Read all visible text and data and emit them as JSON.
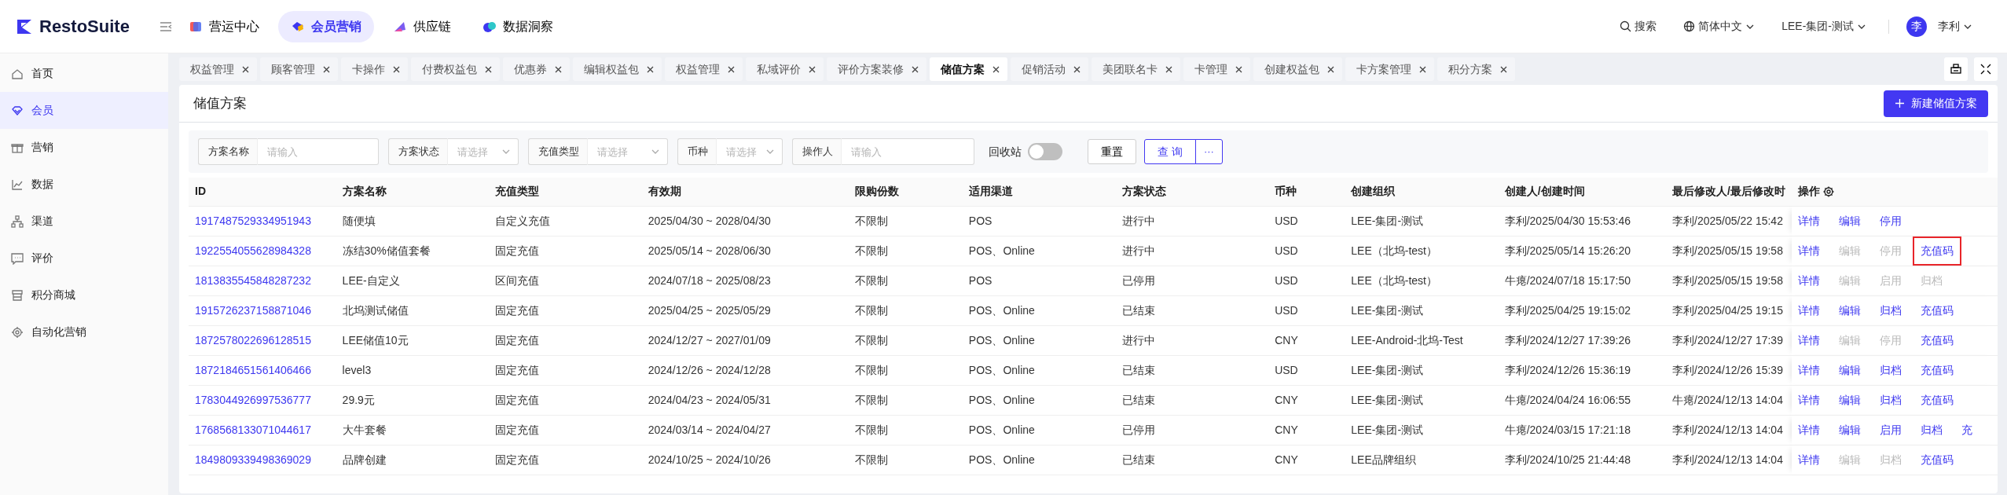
{
  "app": {
    "logo": "RestoSuite"
  },
  "top_nav": [
    {
      "label": "营运中心",
      "selected": false
    },
    {
      "label": "会员营销",
      "selected": true
    },
    {
      "label": "供应链",
      "selected": false
    },
    {
      "label": "数据洞察",
      "selected": false
    }
  ],
  "header_right": {
    "search": "搜索",
    "language": "简体中文",
    "org": "LEE-集团-测试",
    "user": {
      "avatar": "李",
      "name": "李利"
    }
  },
  "sidebar": {
    "items": [
      {
        "label": "首页",
        "selected": false
      },
      {
        "label": "会员",
        "selected": true
      },
      {
        "label": "营销",
        "selected": false
      },
      {
        "label": "数据",
        "selected": false
      },
      {
        "label": "渠道",
        "selected": false
      },
      {
        "label": "评价",
        "selected": false
      },
      {
        "label": "积分商城",
        "selected": false
      },
      {
        "label": "自动化营销",
        "selected": false
      }
    ]
  },
  "tabs": [
    {
      "label": "权益管理",
      "selected": false
    },
    {
      "label": "顾客管理",
      "selected": false
    },
    {
      "label": "卡操作",
      "selected": false
    },
    {
      "label": "付费权益包",
      "selected": false
    },
    {
      "label": "优惠券",
      "selected": false
    },
    {
      "label": "编辑权益包",
      "selected": false
    },
    {
      "label": "权益管理",
      "selected": false
    },
    {
      "label": "私域评价",
      "selected": false
    },
    {
      "label": "评价方案装修",
      "selected": false
    },
    {
      "label": "储值方案",
      "selected": true
    },
    {
      "label": "促销活动",
      "selected": false
    },
    {
      "label": "美团联名卡",
      "selected": false
    },
    {
      "label": "卡管理",
      "selected": false
    },
    {
      "label": "创建权益包",
      "selected": false
    },
    {
      "label": "卡方案管理",
      "selected": false
    },
    {
      "label": "积分方案",
      "selected": false
    }
  ],
  "page": {
    "title": "储值方案",
    "new_button": "新建储值方案"
  },
  "filters": [
    {
      "kind": "input",
      "label": "方案名称",
      "placeholder": "请输入"
    },
    {
      "kind": "select",
      "label": "方案状态",
      "placeholder": "请选择"
    },
    {
      "kind": "select",
      "label": "充值类型",
      "placeholder": "请选择"
    },
    {
      "kind": "select",
      "label": "币种",
      "placeholder": "请选择"
    },
    {
      "kind": "input",
      "label": "操作人",
      "placeholder": "请输入"
    }
  ],
  "recycle_bin": {
    "label": "回收站",
    "on": false
  },
  "buttons": {
    "reset": "重置",
    "query": "查 询",
    "more": "···"
  },
  "table": {
    "columns": [
      "ID",
      "方案名称",
      "充值类型",
      "有效期",
      "限购份数",
      "适用渠道",
      "方案状态",
      "币种",
      "创建组织",
      "创建人/创建时间",
      "最后修改人/最后修改时",
      "操作"
    ],
    "rows": [
      {
        "cells": [
          "1917487529334951943",
          "随便填",
          "自定义充值",
          "2025/04/30 ~ 2028/04/30",
          "不限制",
          "POS",
          "进行中",
          "USD",
          "LEE-集团-测试",
          "李利/2025/04/30 15:53:46",
          "李利/2025/05/22 15:42"
        ],
        "actions": [
          {
            "label": "详情",
            "disabled": false,
            "highlighted": false
          },
          {
            "label": "编辑",
            "disabled": false,
            "highlighted": false
          },
          {
            "label": "停用",
            "disabled": false,
            "highlighted": false
          }
        ]
      },
      {
        "cells": [
          "1922554055628984328",
          "冻结30%储值套餐",
          "固定充值",
          "2025/05/14 ~ 2028/06/30",
          "不限制",
          "POS、Online",
          "进行中",
          "USD",
          "LEE（北坞-test）",
          "李利/2025/05/14 15:26:20",
          "李利/2025/05/15 19:58"
        ],
        "actions": [
          {
            "label": "详情",
            "disabled": false,
            "highlighted": false
          },
          {
            "label": "编辑",
            "disabled": true,
            "highlighted": false
          },
          {
            "label": "停用",
            "disabled": true,
            "highlighted": false
          },
          {
            "label": "充值码",
            "disabled": false,
            "highlighted": true
          }
        ]
      },
      {
        "cells": [
          "1813835545848287232",
          "LEE-自定义",
          "区间充值",
          "2024/07/18 ~ 2025/08/23",
          "不限制",
          "POS",
          "已停用",
          "USD",
          "LEE（北坞-test）",
          "牛瘪/2024/07/18 15:17:50",
          "李利/2025/05/15 19:58"
        ],
        "actions": [
          {
            "label": "详情",
            "disabled": false,
            "highlighted": false
          },
          {
            "label": "编辑",
            "disabled": true,
            "highlighted": false
          },
          {
            "label": "启用",
            "disabled": true,
            "highlighted": false
          },
          {
            "label": "归档",
            "disabled": true,
            "highlighted": false
          }
        ]
      },
      {
        "cells": [
          "1915726237158871046",
          "北坞测试储值",
          "固定充值",
          "2025/04/25 ~ 2025/05/29",
          "不限制",
          "POS、Online",
          "已结束",
          "USD",
          "LEE-集团-测试",
          "李利/2025/04/25 19:15:02",
          "李利/2025/04/25 19:15"
        ],
        "actions": [
          {
            "label": "详情",
            "disabled": false,
            "highlighted": false
          },
          {
            "label": "编辑",
            "disabled": false,
            "highlighted": false
          },
          {
            "label": "归档",
            "disabled": false,
            "highlighted": false
          },
          {
            "label": "充值码",
            "disabled": false,
            "highlighted": false
          }
        ]
      },
      {
        "cells": [
          "1872578022696128515",
          "LEE储值10元",
          "固定充值",
          "2024/12/27 ~ 2027/01/09",
          "不限制",
          "POS、Online",
          "进行中",
          "CNY",
          "LEE-Android-北坞-Test",
          "李利/2024/12/27 17:39:26",
          "李利/2024/12/27 17:39"
        ],
        "actions": [
          {
            "label": "详情",
            "disabled": false,
            "highlighted": false
          },
          {
            "label": "编辑",
            "disabled": true,
            "highlighted": false
          },
          {
            "label": "停用",
            "disabled": true,
            "highlighted": false
          },
          {
            "label": "充值码",
            "disabled": false,
            "highlighted": false
          }
        ]
      },
      {
        "cells": [
          "1872184651561406466",
          "level3",
          "固定充值",
          "2024/12/26 ~ 2024/12/28",
          "不限制",
          "POS、Online",
          "已结束",
          "USD",
          "LEE-集团-测试",
          "李利/2024/12/26 15:36:19",
          "李利/2024/12/26 15:39"
        ],
        "actions": [
          {
            "label": "详情",
            "disabled": false,
            "highlighted": false
          },
          {
            "label": "编辑",
            "disabled": false,
            "highlighted": false
          },
          {
            "label": "归档",
            "disabled": false,
            "highlighted": false
          },
          {
            "label": "充值码",
            "disabled": false,
            "highlighted": false
          }
        ]
      },
      {
        "cells": [
          "1783044926997536777",
          "29.9元",
          "固定充值",
          "2024/04/23 ~ 2024/05/31",
          "不限制",
          "POS、Online",
          "已结束",
          "CNY",
          "LEE-集团-测试",
          "牛瘪/2024/04/24 16:06:55",
          "牛瘪/2024/12/13 14:04"
        ],
        "actions": [
          {
            "label": "详情",
            "disabled": false,
            "highlighted": false
          },
          {
            "label": "编辑",
            "disabled": false,
            "highlighted": false
          },
          {
            "label": "归档",
            "disabled": false,
            "highlighted": false
          },
          {
            "label": "充值码",
            "disabled": false,
            "highlighted": false
          }
        ]
      },
      {
        "cells": [
          "1768568133071044617",
          "大牛套餐",
          "固定充值",
          "2024/03/14 ~ 2024/04/27",
          "不限制",
          "POS、Online",
          "已停用",
          "CNY",
          "LEE-集团-测试",
          "牛瘪/2024/03/15 17:21:18",
          "李利/2024/12/13 14:04"
        ],
        "actions": [
          {
            "label": "详情",
            "disabled": false,
            "highlighted": false
          },
          {
            "label": "编辑",
            "disabled": false,
            "highlighted": false
          },
          {
            "label": "启用",
            "disabled": false,
            "highlighted": false
          },
          {
            "label": "归档",
            "disabled": false,
            "highlighted": false
          },
          {
            "label": "充",
            "disabled": false,
            "highlighted": false
          }
        ]
      },
      {
        "cells": [
          "1849809339498369029",
          "品牌创建",
          "固定充值",
          "2024/10/25 ~ 2024/10/26",
          "不限制",
          "POS、Online",
          "已结束",
          "CNY",
          "LEE品牌组织",
          "李利/2024/10/25 21:44:48",
          "李利/2024/12/13 14:04"
        ],
        "actions": [
          {
            "label": "详情",
            "disabled": false,
            "highlighted": false
          },
          {
            "label": "编辑",
            "disabled": true,
            "highlighted": false
          },
          {
            "label": "归档",
            "disabled": true,
            "highlighted": false
          },
          {
            "label": "充值码",
            "disabled": false,
            "highlighted": false
          }
        ]
      }
    ]
  }
}
